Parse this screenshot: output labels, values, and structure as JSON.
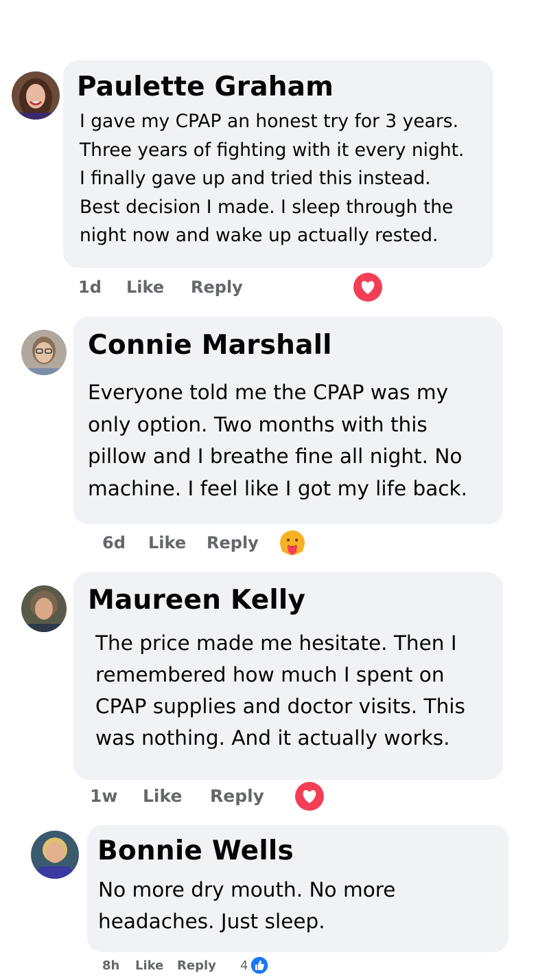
{
  "comments": [
    {
      "name": "Paulette Graham",
      "text": "I gave my CPAP an honest try for 3 years.\nThree years of fighting with it every night.\nI finally gave up and tried this instead.\nBest decision I made. I sleep through the\nnight now and wake up actually rested.",
      "time": "1d",
      "like_label": "Like",
      "reply_label": "Reply",
      "reaction_icon": "love-reaction-icon",
      "reaction_color": "#f33e58"
    },
    {
      "name": "Connie Marshall",
      "text": "Everyone told me the CPAP was my\nonly option. Two months with this\npillow and I breathe fine all night. No\nmachine. I feel like I got my life back.",
      "time": "6d",
      "like_label": "Like",
      "reply_label": "Reply",
      "reaction_icon": "care-reaction-icon",
      "reaction_color": "#f7b125"
    },
    {
      "name": "Maureen Kelly",
      "text": "The price made me hesitate. Then I\nremembered how much I spent on\nCPAP supplies and doctor visits. This\nwas nothing. And it actually works.",
      "time": "1w",
      "like_label": "Like",
      "reply_label": "Reply",
      "reaction_icon": "love-reaction-icon",
      "reaction_color": "#f33e58"
    },
    {
      "name": "Bonnie Wells",
      "text": "No more dry mouth. No more\nheadaches. Just sleep.",
      "time": "8h",
      "like_label": "Like",
      "reply_label": "Reply",
      "reaction_icon": "like-reaction-icon",
      "reaction_color": "#1877f2",
      "reaction_count": "4"
    }
  ],
  "colors": {
    "bubble": "#f0f2f5",
    "meta_text": "#65676b"
  }
}
